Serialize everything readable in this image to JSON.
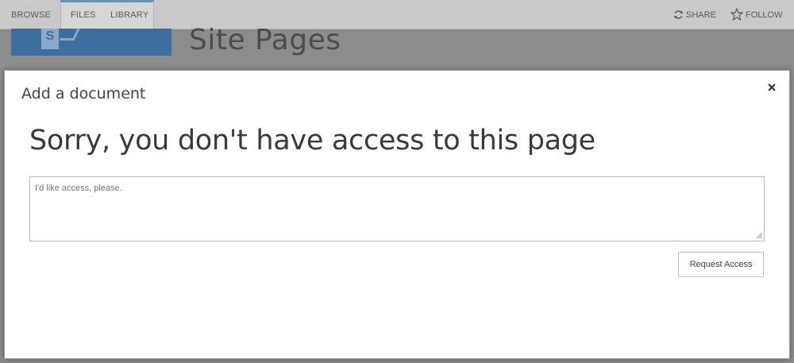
{
  "ribbon": {
    "tabs": [
      "BROWSE",
      "FILES",
      "LIBRARY"
    ],
    "actions": {
      "share_label": "SHARE",
      "follow_label": "FOLLOW",
      "share_icon": "sync-icon",
      "follow_icon": "star-icon"
    }
  },
  "site": {
    "title": "Site Pages",
    "logo_letter": "S"
  },
  "dialog": {
    "title": "Add a document",
    "heading": "Sorry, you don't have access to this page",
    "message_placeholder": "I'd like access, please.",
    "request_button_label": "Request Access",
    "close_icon": "close-icon"
  },
  "colors": {
    "ribbon_bg": "#c9c9c9",
    "logo_blue": "#3d6f9e",
    "overlay": "#8c8c8c",
    "dialog_bg": "#ffffff"
  }
}
